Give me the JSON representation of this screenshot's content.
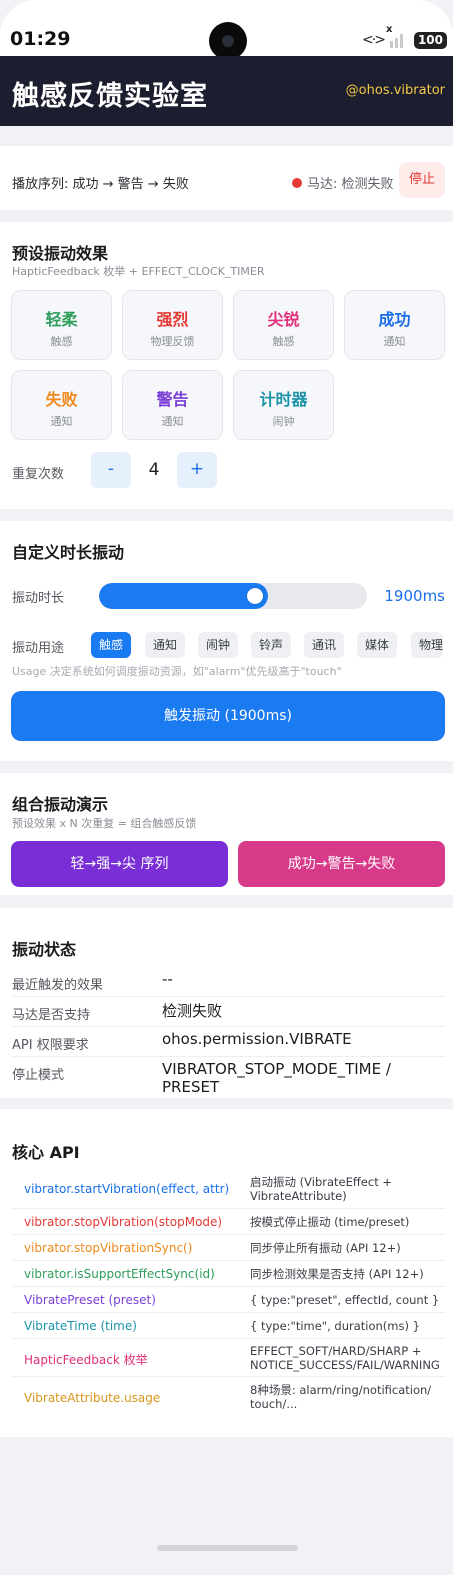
{
  "status_bar": {
    "time": "01:29",
    "signal_x": "x",
    "battery": "100"
  },
  "header": {
    "title": "触感反馈实验室",
    "tag": "@ohos.vibrator"
  },
  "sequence": {
    "text": "播放序列: 成功 → 警告 → 失败",
    "motor_status": "马达: 检测失败",
    "stop_label": "停止"
  },
  "presets": {
    "title": "预设振动效果",
    "subtitle": "HapticFeedback 枚举 + EFFECT_CLOCK_TIMER",
    "items": [
      {
        "name": "轻柔",
        "sub": "触感",
        "color": "#2e9e5b"
      },
      {
        "name": "强烈",
        "sub": "物理反馈",
        "color": "#e53935"
      },
      {
        "name": "尖锐",
        "sub": "触感",
        "color": "#e0307a"
      },
      {
        "name": "成功",
        "sub": "通知",
        "color": "#1a6fe8"
      },
      {
        "name": "失败",
        "sub": "通知",
        "color": "#f08a1c"
      },
      {
        "name": "警告",
        "sub": "通知",
        "color": "#7a3fd6"
      },
      {
        "name": "计时器",
        "sub": "闹钟",
        "color": "#1b93a8"
      }
    ],
    "repeat_label": "重复次数",
    "repeat_minus": "-",
    "repeat_value": "4",
    "repeat_plus": "+"
  },
  "custom": {
    "title": "自定义时长振动",
    "duration_label": "振动时长",
    "duration_value": "1900ms",
    "slider_fraction": 0.63,
    "usage_label": "振动用途",
    "usages": [
      "触感",
      "通知",
      "闹钟",
      "铃声",
      "通讯",
      "媒体",
      "物理"
    ],
    "usage_selected": "触感",
    "hint": "Usage 决定系统如何调度振动资源，如\"alarm\"优先级高于\"touch\"",
    "trigger_label": "触发振动 (1900ms)"
  },
  "combo": {
    "title": "组合振动演示",
    "subtitle": "预设效果 x N 次重复 = 组合触感反馈",
    "btn1": "轻→强→尖 序列",
    "btn2": "成功→警告→失败",
    "btn1_color": "#7a2fd6",
    "btn2_color": "#d83a8a"
  },
  "status": {
    "title": "振动状态",
    "rows": [
      {
        "k": "最近触发的效果",
        "v": "--"
      },
      {
        "k": "马达是否支持",
        "v": "检测失败"
      },
      {
        "k": "API 权限要求",
        "v": "ohos.permission.VIBRATE"
      },
      {
        "k": "停止模式",
        "v": "VIBRATOR_STOP_MODE_TIME / PRESET"
      }
    ]
  },
  "api": {
    "title": "核心 API",
    "rows": [
      {
        "fn": "vibrator.startVibration(effect, attr)",
        "desc": "启动振动 (VibrateEffect + VibrateAttribute)",
        "color": "#1a6fe8"
      },
      {
        "fn": "vibrator.stopVibration(stopMode)",
        "desc": "按模式停止振动 (time/preset)",
        "color": "#e53935"
      },
      {
        "fn": "vibrator.stopVibrationSync()",
        "desc": "同步停止所有振动 (API 12+)",
        "color": "#f08a1c"
      },
      {
        "fn": "vibrator.isSupportEffectSync(id)",
        "desc": "同步检测效果是否支持 (API 12+)",
        "color": "#2e9e5b"
      },
      {
        "fn": "VibratePreset (preset)",
        "desc": "{ type:\"preset\", effectId, count }",
        "color": "#7a3fd6"
      },
      {
        "fn": "VibrateTime (time)",
        "desc": "{ type:\"time\", duration(ms) }",
        "color": "#1b93a8"
      },
      {
        "fn": "HapticFeedback 枚举",
        "desc": "EFFECT_SOFT/HARD/SHARP + NOTICE_SUCCESS/FAIL/WARNING",
        "color": "#e0307a"
      },
      {
        "fn": "VibrateAttribute.usage",
        "desc": "8种场景: alarm/ring/notification/ touch/...",
        "color": "#d4961a"
      }
    ]
  }
}
